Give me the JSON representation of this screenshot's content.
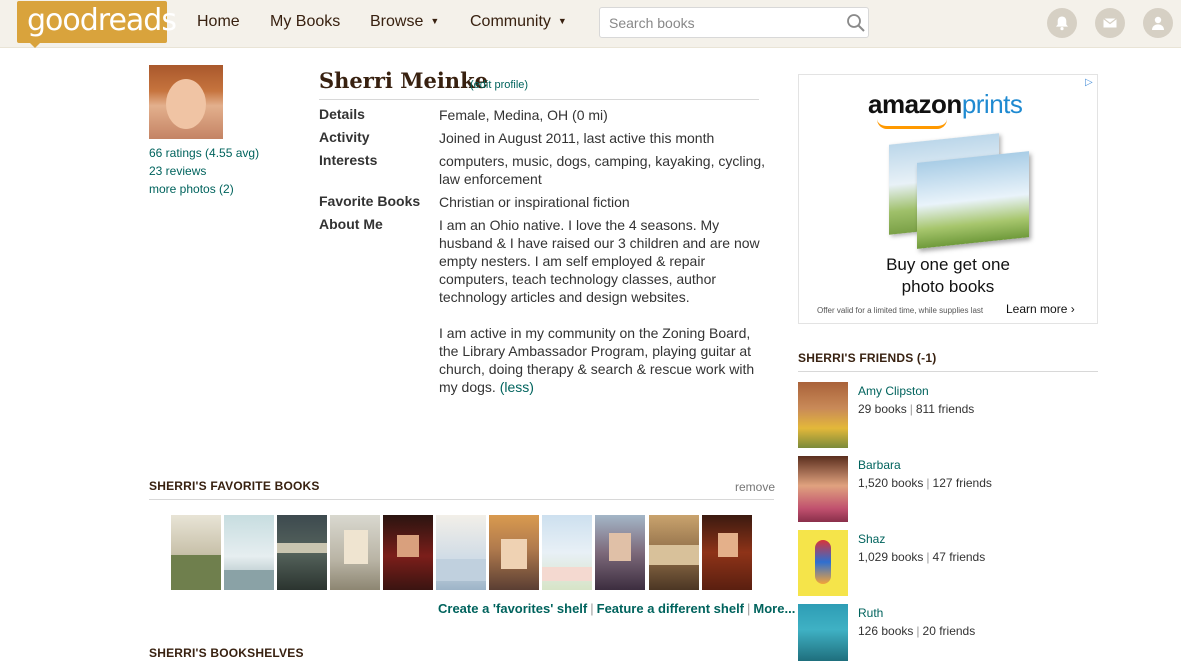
{
  "header": {
    "logo": "goodreads",
    "nav": [
      {
        "label": "Home"
      },
      {
        "label": "My Books"
      },
      {
        "label": "Browse"
      },
      {
        "label": "Community"
      }
    ],
    "search_placeholder": "Search books",
    "icons": [
      "bell-icon",
      "mail-icon",
      "friends-icon"
    ],
    "brand_color": "#d9a33c",
    "bar_color": "#f4f1ea"
  },
  "profile": {
    "name": "Sherri Meinke",
    "edit_label": "(edit profile)",
    "ratings": "66 ratings (4.55 avg)",
    "reviews": "23 reviews",
    "more_photos": "more photos (2)",
    "details": [
      {
        "label": "Details",
        "lines": [
          "Female, Medina, OH (0 mi)"
        ]
      },
      {
        "label": "Activity",
        "lines": [
          "Joined in August 2011, last active this month"
        ]
      },
      {
        "label": "Interests",
        "lines": [
          "computers, music, dogs, camping, kayaking, cycling,",
          "law enforcement"
        ]
      },
      {
        "label": "Favorite Books",
        "lines": [
          "Christian or inspirational fiction"
        ]
      },
      {
        "label": "About Me",
        "lines": [
          "I am an Ohio native. I love the 4 seasons. My",
          "husband & I have raised our 3 children and are now",
          "empty nesters. I am self employed & repair",
          "computers, teach technology classes, author",
          "technology articles and design websites.",
          "",
          "I am active in my community on the Zoning Board,",
          "the Library Ambassador Program, playing guitar at",
          "church, doing therapy & search & rescue work with",
          "my dogs."
        ]
      }
    ],
    "less_label": "(less)"
  },
  "favorites": {
    "heading": "SHERRI'S FAVORITE BOOKS",
    "remove_label": "remove",
    "links": [
      "Create a 'favorites' shelf",
      "Feature a different shelf",
      "More..."
    ]
  },
  "bookshelves": {
    "heading": "SHERRI'S BOOKSHELVES"
  },
  "ad": {
    "brand_a": "amazon",
    "brand_b": "prints",
    "line1": "Buy one get one",
    "line2": "photo books",
    "fine_print": "Offer valid for a limited time, while supplies last",
    "cta": "Learn more ›"
  },
  "friends": {
    "heading": "SHERRI'S FRIENDS (-1)",
    "items": [
      {
        "name": "Amy Clipston",
        "books": "29 books",
        "friends": "811 friends"
      },
      {
        "name": "Barbara",
        "books": "1,520 books",
        "friends": "127 friends"
      },
      {
        "name": "Shaz",
        "books": "1,029 books",
        "friends": "47 friends"
      },
      {
        "name": "Ruth",
        "books": "126 books",
        "friends": "20 friends"
      }
    ]
  },
  "colors": {
    "link": "#00635d",
    "heading": "#382110"
  }
}
